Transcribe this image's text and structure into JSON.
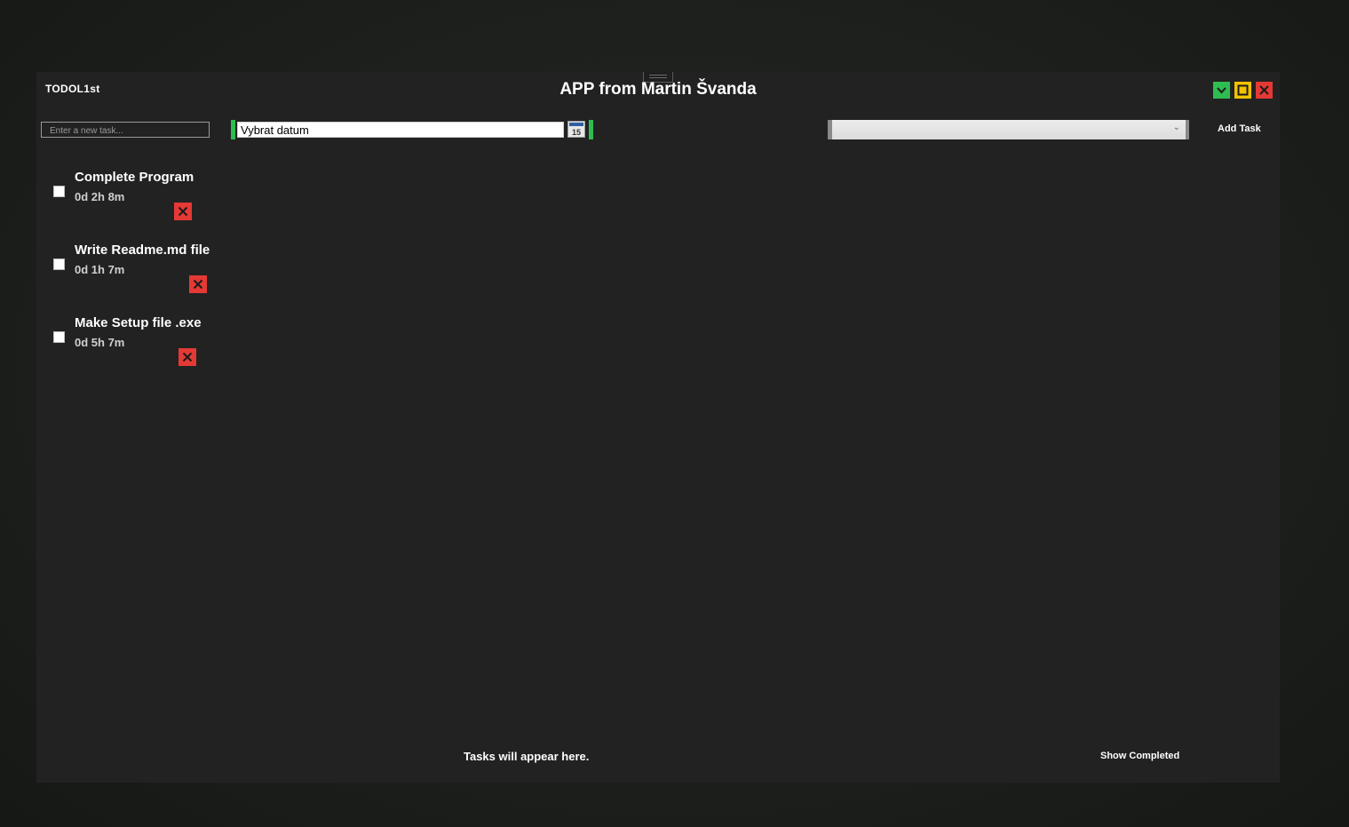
{
  "app": {
    "name": "TODOL1st",
    "title": "APP from Martin Švanda"
  },
  "window_controls": {
    "minimize_color": "#2ebd50",
    "maximize_color": "#f2c200",
    "close_color": "#e53935"
  },
  "toolbar": {
    "task_placeholder": "Enter a new task...",
    "date_value": "Vybrat datum",
    "calendar_day": "15",
    "category_value": "",
    "add_label": "Add Task",
    "accent_color": "#2ebd50"
  },
  "tasks": [
    {
      "title": "Complete Program",
      "time": "0d 2h 8m",
      "done": false
    },
    {
      "title": "Write Readme.md file",
      "time": "0d 1h 7m",
      "done": false
    },
    {
      "title": "Make Setup file .exe",
      "time": "0d 5h 7m",
      "done": false
    }
  ],
  "footer": {
    "empty_message": "Tasks will appear here.",
    "show_completed_label": "Show Completed"
  }
}
